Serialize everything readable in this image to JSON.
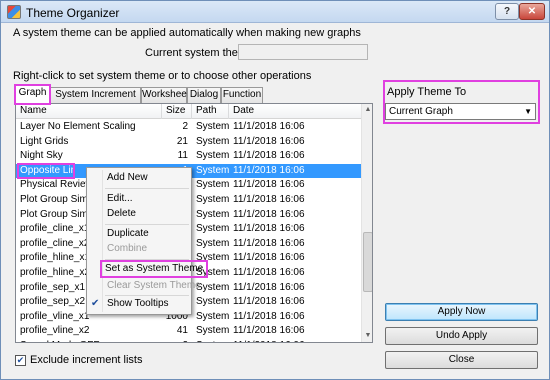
{
  "window": {
    "title": "Theme Organizer",
    "help_label": "?",
    "close_label": "✕"
  },
  "intro_text": "A system theme can be applied automatically when making new graphs",
  "current_theme": {
    "label": "Current system theme:",
    "value": ""
  },
  "instruction_text": "Right-click to set system theme or to choose other operations",
  "tabs": [
    {
      "label": "Graph",
      "active": true
    },
    {
      "label": "System Increment Lists"
    },
    {
      "label": "Worksheet"
    },
    {
      "label": "Dialog"
    },
    {
      "label": "Function"
    }
  ],
  "list": {
    "columns": [
      "Name",
      "Size",
      "Path",
      "Date"
    ],
    "rows": [
      {
        "name": "Layer No Element Scaling",
        "size": "2",
        "path": "System",
        "date": "11/1/2018 16:06"
      },
      {
        "name": "Light Grids",
        "size": "21",
        "path": "System",
        "date": "11/1/2018 16:06"
      },
      {
        "name": "Night Sky",
        "size": "11",
        "path": "System",
        "date": "11/1/2018 16:06"
      },
      {
        "name": "Opposite Lines",
        "size": "1",
        "path": "System",
        "date": "11/1/2018 16:06",
        "selected": true
      },
      {
        "name": "Physical Review Le",
        "size": "",
        "path": "System",
        "date": "11/1/2018 16:06"
      },
      {
        "name": "Plot Group Simple",
        "size": "",
        "path": "System",
        "date": "11/1/2018 16:06"
      },
      {
        "name": "Plot Group Simple",
        "size": "",
        "path": "System",
        "date": "11/1/2018 16:06"
      },
      {
        "name": "profile_cline_x1",
        "size": "",
        "path": "System",
        "date": "11/1/2018 16:06"
      },
      {
        "name": "profile_cline_x2",
        "size": "",
        "path": "System",
        "date": "11/1/2018 16:06"
      },
      {
        "name": "profile_hline_x1",
        "size": "",
        "path": "System",
        "date": "11/1/2018 16:06"
      },
      {
        "name": "profile_hline_x2",
        "size": "",
        "path": "System",
        "date": "11/1/2018 16:06"
      },
      {
        "name": "profile_sep_x1",
        "size": "",
        "path": "System",
        "date": "11/1/2018 16:06"
      },
      {
        "name": "profile_sep_x2",
        "size": "",
        "path": "System",
        "date": "11/1/2018 16:06"
      },
      {
        "name": "profile_vline_x1",
        "size": "1000",
        "path": "System",
        "date": "11/1/2018 16:06"
      },
      {
        "name": "profile_vline_x2",
        "size": "41",
        "path": "System",
        "date": "11/1/2018 16:06"
      },
      {
        "name": "Speed Mode OFF",
        "size": "2",
        "path": "System",
        "date": "11/1/2018 16:06"
      }
    ]
  },
  "context_menu": {
    "items": [
      {
        "label": "Add New",
        "disabled": false
      },
      {
        "label": "Edit...",
        "disabled": false
      },
      {
        "label": "Delete",
        "disabled": false
      },
      {
        "label": "Duplicate",
        "disabled": false
      },
      {
        "label": "Combine",
        "disabled": true
      },
      {
        "label": "Set as System Theme",
        "disabled": false
      },
      {
        "label": "Clear System Theme",
        "disabled": true
      },
      {
        "label": "Show Tooltips",
        "disabled": false,
        "checked": true
      }
    ]
  },
  "exclude_checkbox": {
    "label": "Exclude increment lists",
    "checked": true
  },
  "apply_theme": {
    "label": "Apply Theme To",
    "selected": "Current Graph"
  },
  "buttons": {
    "apply_now": "Apply Now",
    "undo_apply": "Undo Apply",
    "close": "Close"
  },
  "colors": {
    "selection": "#3399ff",
    "highlight_outline": "#e040e0"
  }
}
